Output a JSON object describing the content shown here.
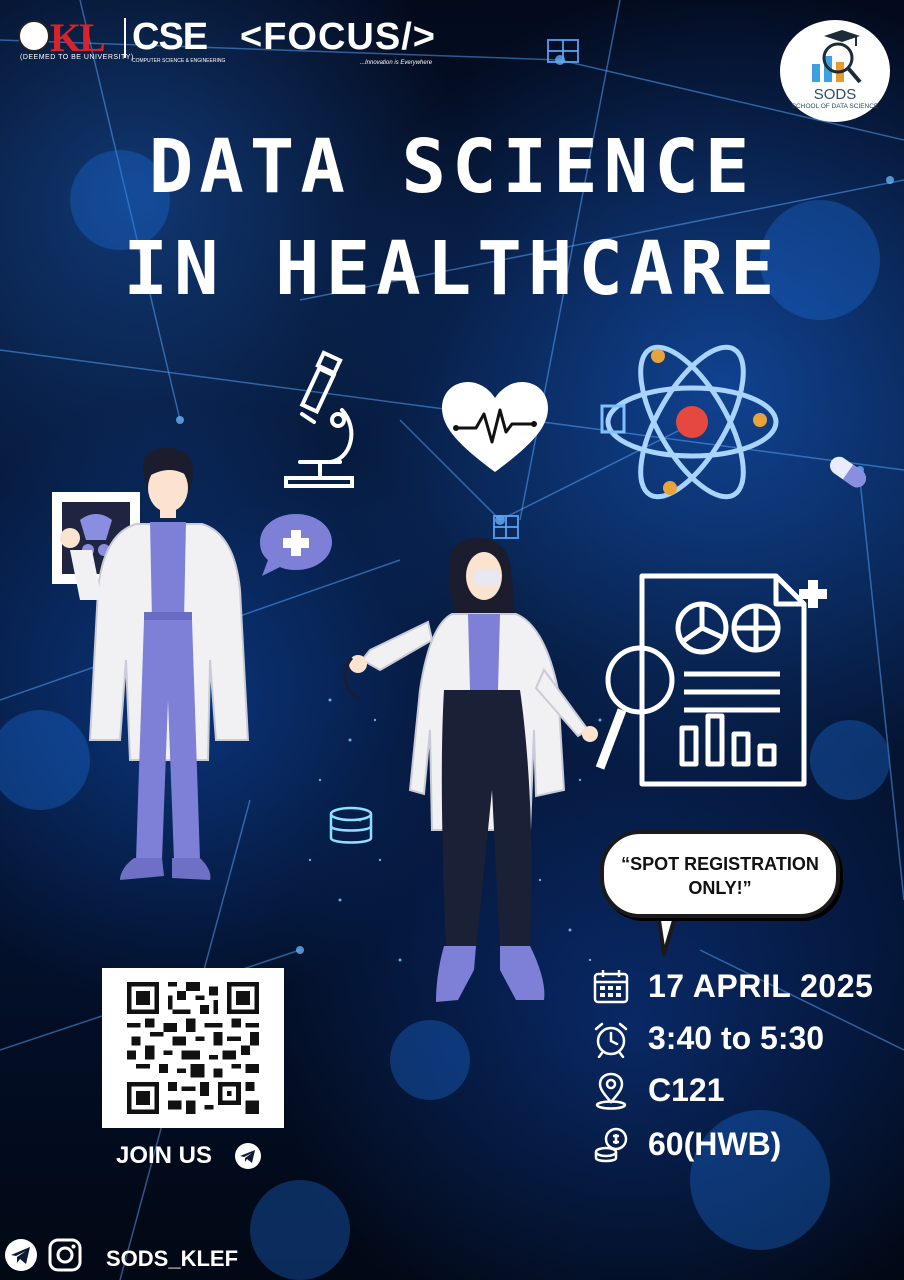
{
  "header": {
    "kl_logo_text": "KL",
    "kl_logo_subtext": "(DEEMED TO BE UNIVERSITY)",
    "cse_logo_text": "CSE",
    "cse_logo_subtext": "COMPUTER SCIENCE & ENGINEERING",
    "focus_logo_text": "<FOCUS/>",
    "focus_tagline": "...Innovation is Everywhere",
    "sods_logo_text": "SODS",
    "sods_logo_subtext": "SCHOOL OF DATA SCIENCE"
  },
  "title": {
    "line1": "DATA SCIENCE",
    "line2": "IN HEALTHCARE"
  },
  "bubble": {
    "line1": "“SPOT REGISTRATION",
    "line2": "ONLY!”"
  },
  "details": {
    "date": "17 APRIL 2025",
    "time": "3:40 to 5:30",
    "venue": "C121",
    "fee": "60(HWB)"
  },
  "join": {
    "label": "JOIN US"
  },
  "footer": {
    "handle": "SODS_KLEF"
  },
  "icons": {
    "calendar": "calendar-icon",
    "clock": "alarm-clock-icon",
    "location": "location-pin-icon",
    "coins": "coins-icon",
    "telegram": "telegram-icon",
    "instagram": "instagram-icon"
  },
  "colors": {
    "background_dark": "#030a1c",
    "background_glow": "#1e78ff",
    "figure_purple": "#7d80d6",
    "text_white": "#ffffff",
    "kl_red": "#d8232a",
    "focus_orange": "#e85a1b"
  }
}
